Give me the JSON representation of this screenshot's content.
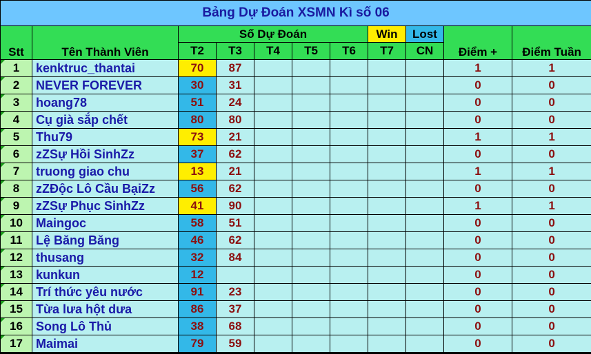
{
  "title": "Bảng Dự Đoán XSMN Kì số 06",
  "headers": {
    "stt": "Stt",
    "name": "Tên Thành Viên",
    "prediction": "Số Dự Đoán",
    "win": "Win",
    "lost": "Lost",
    "days": [
      "T2",
      "T3",
      "T4",
      "T5",
      "T6",
      "T7",
      "CN"
    ],
    "points": "Điểm +",
    "weekly": "Điểm Tuần"
  },
  "rows": [
    {
      "stt": "1",
      "name": "kenktruc_thantai",
      "t2": "70",
      "t2_result": "win",
      "t3": "87",
      "points": "1",
      "weekly": "1"
    },
    {
      "stt": "2",
      "name": "NEVER FOREVER",
      "t2": "30",
      "t2_result": "lost",
      "t3": "31",
      "points": "0",
      "weekly": "0"
    },
    {
      "stt": "3",
      "name": "hoang78",
      "t2": "51",
      "t2_result": "lost",
      "t3": "24",
      "points": "0",
      "weekly": "0"
    },
    {
      "stt": "4",
      "name": "Cụ già sắp chết",
      "t2": "80",
      "t2_result": "lost",
      "t3": "80",
      "points": "0",
      "weekly": "0"
    },
    {
      "stt": "5",
      "name": "Thu79",
      "t2": "73",
      "t2_result": "win",
      "t3": "21",
      "points": "1",
      "weekly": "1"
    },
    {
      "stt": "6",
      "name": "zZSự Hồi SinhZz",
      "t2": "37",
      "t2_result": "lost",
      "t3": "62",
      "points": "0",
      "weekly": "0"
    },
    {
      "stt": "7",
      "name": "truong giao chu",
      "t2": "13",
      "t2_result": "win",
      "t3": "21",
      "points": "1",
      "weekly": "1"
    },
    {
      "stt": "8",
      "name": "zZĐộc Lô Cầu BạiZz",
      "t2": "56",
      "t2_result": "lost",
      "t3": "62",
      "points": "0",
      "weekly": "0"
    },
    {
      "stt": "9",
      "name": "zZSự Phục SinhZz",
      "t2": "41",
      "t2_result": "win",
      "t3": "90",
      "points": "1",
      "weekly": "1"
    },
    {
      "stt": "10",
      "name": "Maingoc",
      "t2": "58",
      "t2_result": "lost",
      "t3": "51",
      "points": "0",
      "weekly": "0"
    },
    {
      "stt": "11",
      "name": "Lệ Băng Băng",
      "t2": "46",
      "t2_result": "lost",
      "t3": "62",
      "points": "0",
      "weekly": "0"
    },
    {
      "stt": "12",
      "name": "thusang",
      "t2": "32",
      "t2_result": "lost",
      "t3": "84",
      "points": "0",
      "weekly": "0"
    },
    {
      "stt": "13",
      "name": "kunkun",
      "t2": "12",
      "t2_result": "lost",
      "t3": "",
      "points": "0",
      "weekly": "0"
    },
    {
      "stt": "14",
      "name": "Trí thức yêu nước",
      "t2": "91",
      "t2_result": "lost",
      "t3": "23",
      "points": "0",
      "weekly": "0"
    },
    {
      "stt": "15",
      "name": "Từa lưa hột dưa",
      "t2": "86",
      "t2_result": "lost",
      "t3": "37",
      "points": "0",
      "weekly": "0"
    },
    {
      "stt": "16",
      "name": "Song Lô Thủ",
      "t2": "38",
      "t2_result": "lost",
      "t3": "68",
      "points": "0",
      "weekly": "0"
    },
    {
      "stt": "17",
      "name": "Maimai",
      "t2": "79",
      "t2_result": "lost",
      "t3": "59",
      "points": "0",
      "weekly": "0"
    }
  ]
}
